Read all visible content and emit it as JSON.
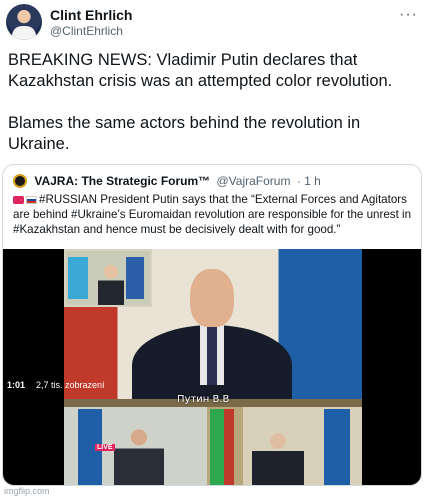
{
  "author": {
    "name": "Clint Ehrlich",
    "handle": "@ClintEhrlich",
    "avatar_icon": "profile-avatar"
  },
  "more_icon": "···",
  "tweet": {
    "paragraph1": "BREAKING NEWS: Vladimir Putin declares that Kazakhstan crisis was an attempted color revolution.",
    "paragraph2": "Blames the same actors behind the revolution in Ukraine."
  },
  "quote": {
    "name": "VAJRA: The Strategic Forum™",
    "handle": "@VajraForum",
    "time": "· 1 h",
    "text": "#RUSSIAN President Putin says that the “External Forces and Agitators are behind #Ukraine’s Euromaidan revolution are responsible for the unrest in #Kazakhstan and hence must be decisively dealt with for good.”"
  },
  "video": {
    "caption": "Путин В.В",
    "live_label": "LIVE",
    "timer": "1:01",
    "views": "2,7 tis. zobrazení"
  },
  "watermark": "imgflip.com",
  "colors": {
    "text": "#0f1419",
    "secondary": "#536471",
    "border": "#cfd9de",
    "live": "#e0245e"
  }
}
